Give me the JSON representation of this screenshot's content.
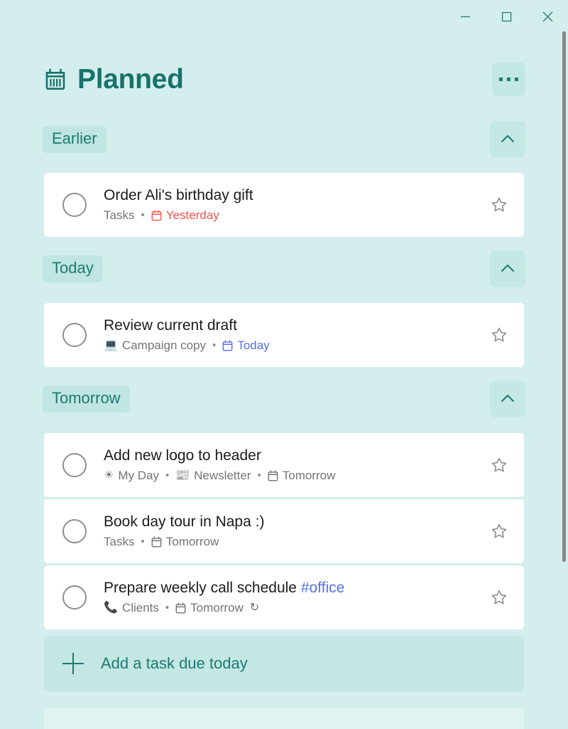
{
  "window": {
    "controls": [
      {
        "name": "minimize",
        "label": "—"
      },
      {
        "name": "maximize",
        "label": "☐"
      },
      {
        "name": "close",
        "label": "✕"
      }
    ]
  },
  "header": {
    "icon": "calendar-icon",
    "title": "Planned",
    "more_label": "…",
    "accent_color": "#16736a",
    "page_background": "#d4eeed"
  },
  "sections": [
    {
      "id": "earlier",
      "label": "Earlier",
      "collapse_icon": "chevron-up-icon",
      "tasks": [
        {
          "title": "Order Ali's birthday gift",
          "tag": "",
          "list_icon": "",
          "list_name": "Tasks",
          "due_icon": "calendar-icon",
          "due": "Yesterday",
          "due_color": "#f0544c",
          "repeat": false,
          "starred": false
        }
      ]
    },
    {
      "id": "today",
      "label": "Today",
      "collapse_icon": "chevron-up-icon",
      "tasks": [
        {
          "title": "Review current draft",
          "tag": "",
          "list_icon": "💻",
          "list_name": "Campaign copy",
          "due_icon": "calendar-icon",
          "due": "Today",
          "due_color": "#5570e8",
          "repeat": false,
          "starred": false
        }
      ]
    },
    {
      "id": "tomorrow",
      "label": "Tomorrow",
      "collapse_icon": "chevron-up-icon",
      "tasks": [
        {
          "title": "Add new logo to header",
          "tag": "",
          "my_day_icon": "☀",
          "my_day": "My Day",
          "list_icon": "📰",
          "list_name": "Newsletter",
          "due_icon": "calendar-icon",
          "due": "Tomorrow",
          "due_color": "#747474",
          "repeat": false,
          "starred": false
        },
        {
          "title": "Book day tour in Napa :)",
          "tag": "",
          "list_icon": "",
          "list_name": "Tasks",
          "due_icon": "calendar-icon",
          "due": "Tomorrow",
          "due_color": "#747474",
          "repeat": false,
          "starred": false
        },
        {
          "title": "Prepare weekly call schedule ",
          "tag": "#office",
          "list_icon": "📞",
          "list_name": "Clients",
          "due_icon": "calendar-icon",
          "due": "Tomorrow",
          "due_color": "#747474",
          "repeat": true,
          "repeat_icon": "↻",
          "starred": false
        }
      ]
    }
  ],
  "add_task": {
    "icon": "plus-icon",
    "label": "Add a task due today"
  },
  "separator": "•"
}
